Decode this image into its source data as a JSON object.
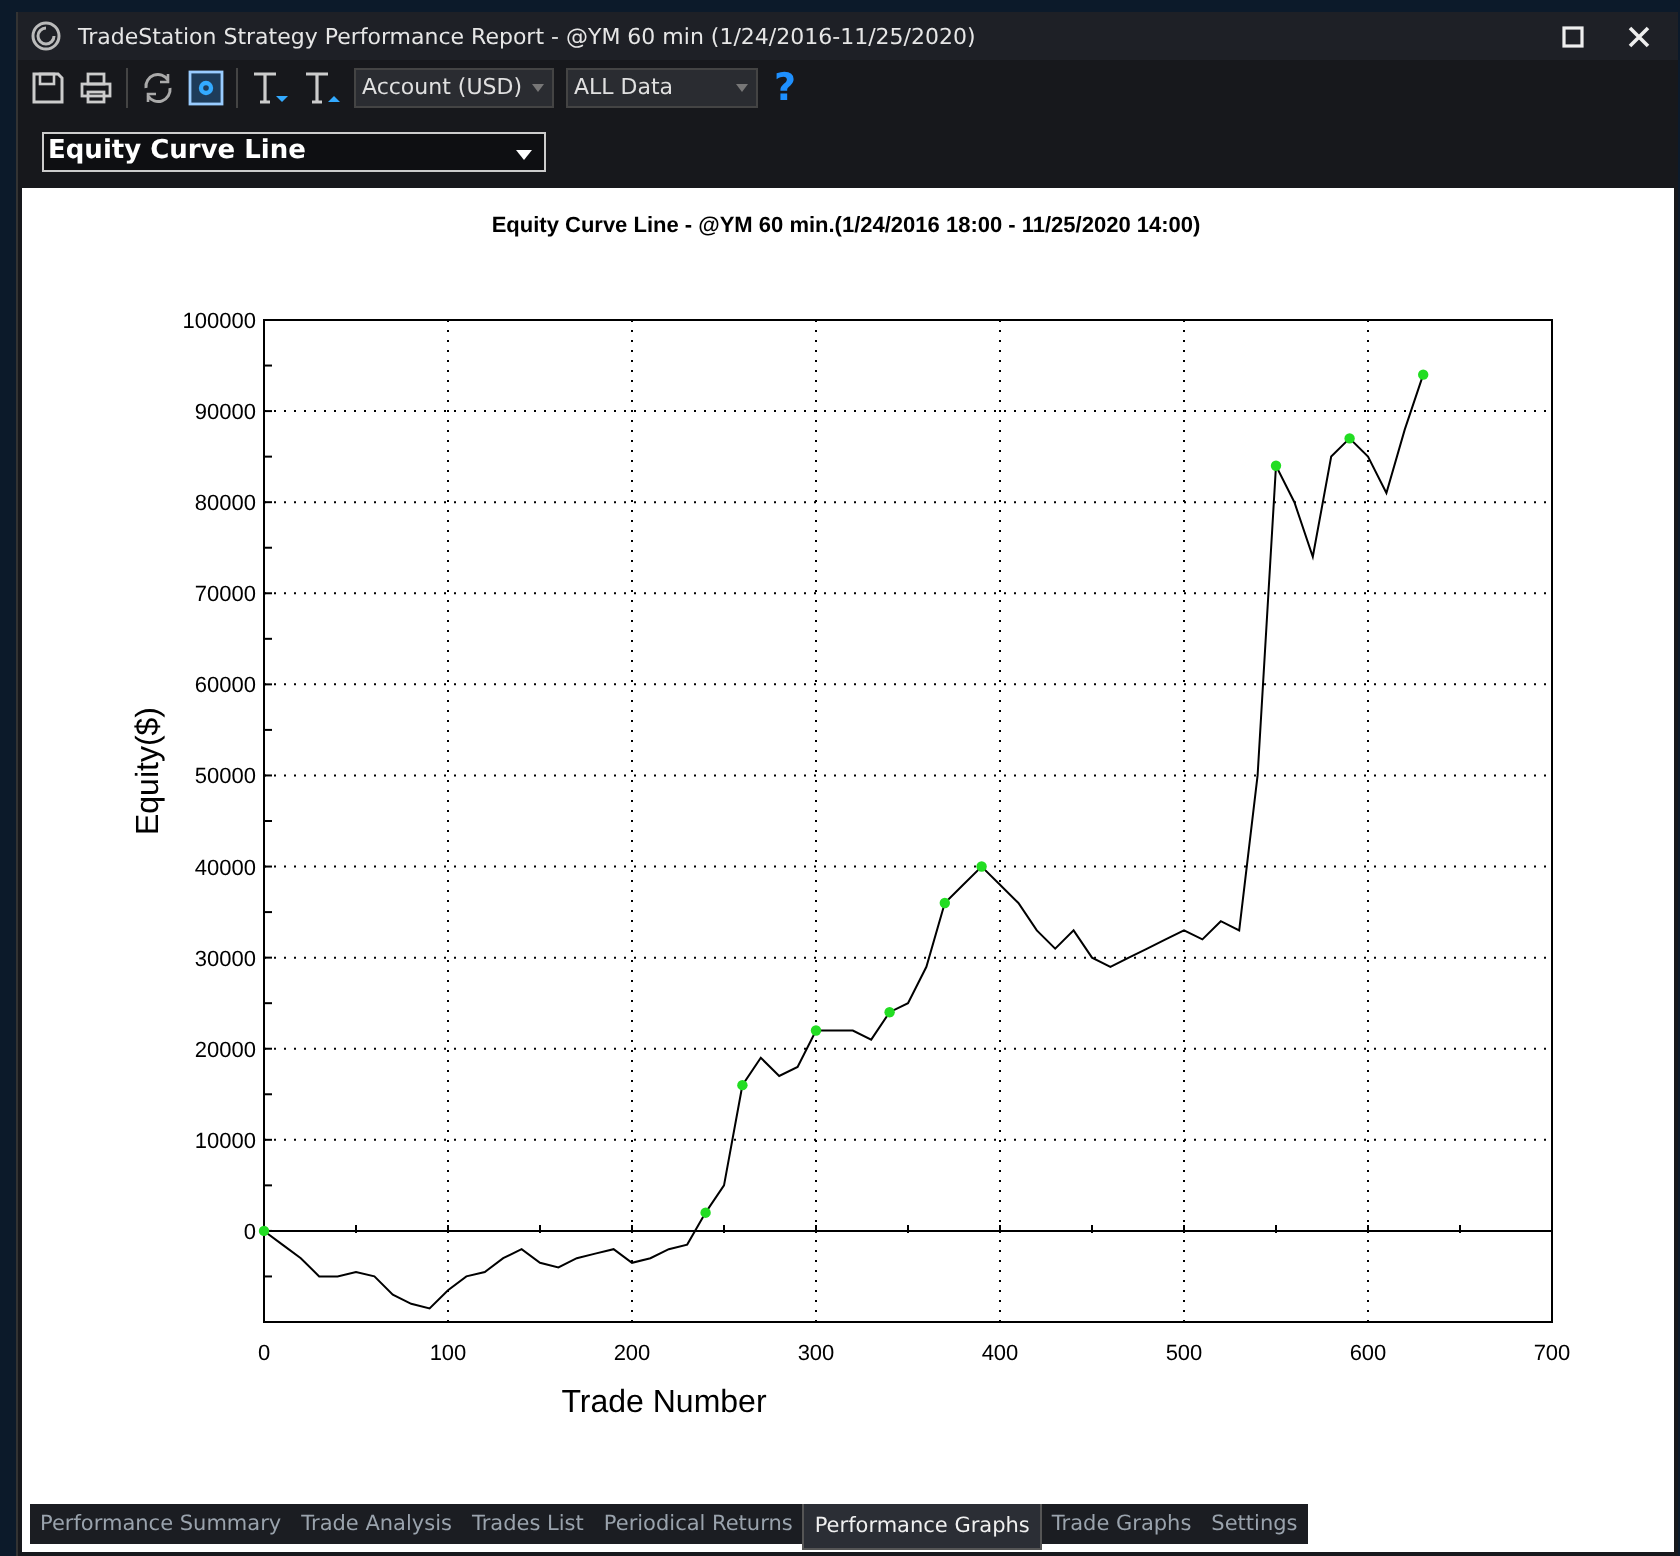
{
  "window": {
    "title": "TradeStation Strategy Performance Report - @YM 60 min (1/24/2016-11/25/2020)"
  },
  "toolbar": {
    "currency": "Account (USD)",
    "range": "ALL Data",
    "help": "?"
  },
  "graph_selector": {
    "value": "Equity Curve Line"
  },
  "chart": {
    "chart_data": {
      "type": "line",
      "title": "Equity Curve Line - @YM 60 min.(1/24/2016 18:00 - 11/25/2020 14:00)",
      "xlabel": "Trade Number",
      "ylabel": "Equity($)",
      "x": [
        0,
        10,
        20,
        30,
        40,
        50,
        60,
        70,
        80,
        90,
        100,
        110,
        120,
        130,
        140,
        150,
        160,
        170,
        180,
        190,
        200,
        210,
        220,
        230,
        240,
        250,
        260,
        270,
        280,
        290,
        300,
        310,
        320,
        330,
        340,
        350,
        360,
        370,
        380,
        390,
        400,
        410,
        420,
        430,
        440,
        450,
        460,
        470,
        480,
        490,
        500,
        510,
        520,
        530,
        540,
        550,
        560,
        570,
        580,
        590,
        600,
        610,
        620,
        630
      ],
      "series": [
        {
          "color": "#000000",
          "values": [
            0,
            -1500,
            -3000,
            -5000,
            -5000,
            -4500,
            -5000,
            -7000,
            -8000,
            -8500,
            -6500,
            -5000,
            -4500,
            -3000,
            -2000,
            -3500,
            -4000,
            -3000,
            -2500,
            -2000,
            -3500,
            -3000,
            -2000,
            -1500,
            2000,
            5000,
            16000,
            19000,
            17000,
            18000,
            22000,
            22000,
            22000,
            21000,
            24000,
            25000,
            29000,
            36000,
            38000,
            40000,
            38000,
            36000,
            33000,
            31000,
            33000,
            30000,
            29000,
            30000,
            31000,
            32000,
            33000,
            32000,
            34000,
            33000,
            50000,
            84000,
            80000,
            74000,
            85000,
            87000,
            85000,
            81000,
            88000,
            94000
          ]
        },
        {
          "color": "#22dd22",
          "marker": "circle",
          "values": [
            0,
            null,
            null,
            null,
            null,
            null,
            null,
            null,
            null,
            null,
            null,
            null,
            null,
            null,
            null,
            null,
            null,
            null,
            null,
            null,
            null,
            null,
            null,
            null,
            2000,
            null,
            16000,
            null,
            null,
            null,
            22000,
            null,
            null,
            null,
            24000,
            null,
            null,
            36000,
            null,
            40000,
            null,
            null,
            null,
            null,
            null,
            null,
            null,
            null,
            null,
            null,
            null,
            null,
            null,
            null,
            null,
            84000,
            null,
            null,
            null,
            87000,
            null,
            null,
            null,
            94000
          ]
        }
      ],
      "grid": true,
      "xlim": [
        0,
        700
      ],
      "ylim": [
        -10000,
        100000
      ],
      "xticks": [
        0,
        100,
        200,
        300,
        400,
        500,
        600,
        700
      ],
      "yticks": [
        0,
        10000,
        20000,
        30000,
        40000,
        50000,
        60000,
        70000,
        80000,
        90000,
        100000
      ]
    }
  },
  "tabs": [
    {
      "label": "Performance Summary",
      "selected": false
    },
    {
      "label": "Trade Analysis",
      "selected": false
    },
    {
      "label": "Trades List",
      "selected": false
    },
    {
      "label": "Periodical Returns",
      "selected": false
    },
    {
      "label": "Performance Graphs",
      "selected": true
    },
    {
      "label": "Trade Graphs",
      "selected": false
    },
    {
      "label": "Settings",
      "selected": false
    }
  ]
}
